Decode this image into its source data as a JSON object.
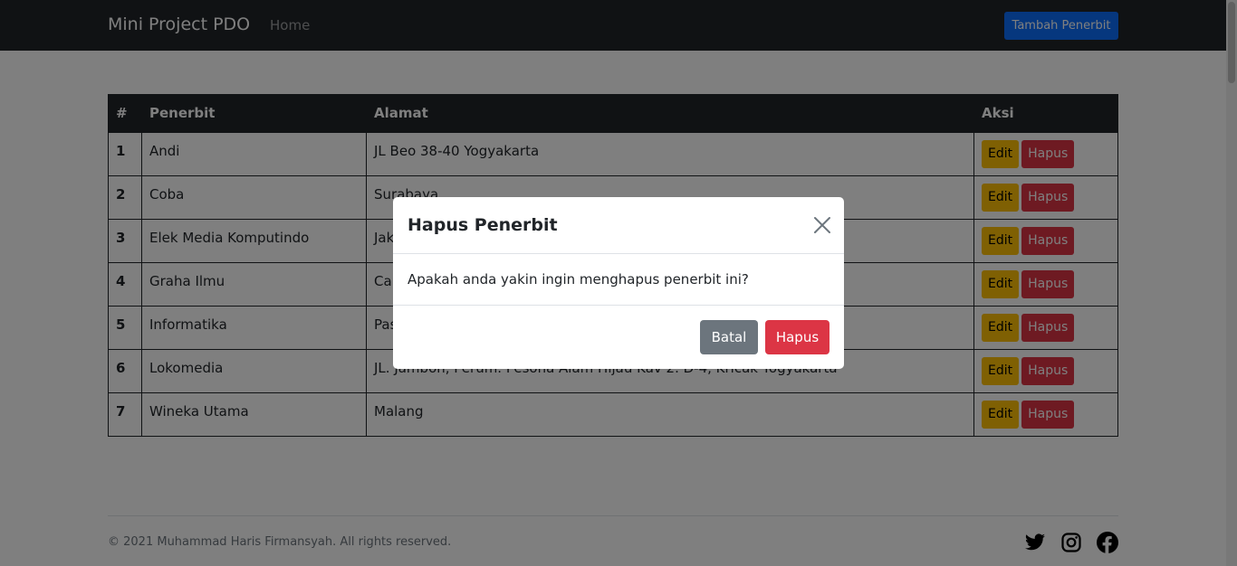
{
  "navbar": {
    "brand": "Mini Project PDO",
    "home": "Home",
    "add_button": "Tambah Penerbit"
  },
  "table": {
    "headers": [
      "#",
      "Penerbit",
      "Alamat",
      "Aksi"
    ],
    "rows": [
      {
        "no": "1",
        "penerbit": "Andi",
        "alamat": "JL Beo 38-40 Yogyakarta"
      },
      {
        "no": "2",
        "penerbit": "Coba",
        "alamat": "Surabaya"
      },
      {
        "no": "3",
        "penerbit": "Elek Media Komputindo",
        "alamat": "Jakarta"
      },
      {
        "no": "4",
        "penerbit": "Graha Ilmu",
        "alamat": "Candi Gebang Permai Blok R/6 Yogyakarta"
      },
      {
        "no": "5",
        "penerbit": "Informatika",
        "alamat": "Pasar Baru 12 Bandung"
      },
      {
        "no": "6",
        "penerbit": "Lokomedia",
        "alamat": "JL. Jambon, Perum. Pesona Alam Hijau Kav 2. D-4, Kricak Yogyakarta"
      },
      {
        "no": "7",
        "penerbit": "Wineka Utama",
        "alamat": "Malang"
      }
    ],
    "edit_label": "Edit",
    "delete_label": "Hapus"
  },
  "footer": {
    "copyright": "© 2021 Muhammad Haris Firmansyah. All rights reserved.",
    "icons": [
      "twitter-icon",
      "instagram-icon",
      "facebook-icon"
    ]
  },
  "modal": {
    "title": "Hapus Penerbit",
    "body": "Apakah anda yakin ingin menghapus penerbit ini?",
    "cancel_label": "Batal",
    "confirm_label": "Hapus"
  },
  "colors": {
    "navbar": "#212529",
    "primary": "#0d6efd",
    "warning": "#ffc107",
    "danger": "#dc3545",
    "secondary": "#6c757d"
  }
}
